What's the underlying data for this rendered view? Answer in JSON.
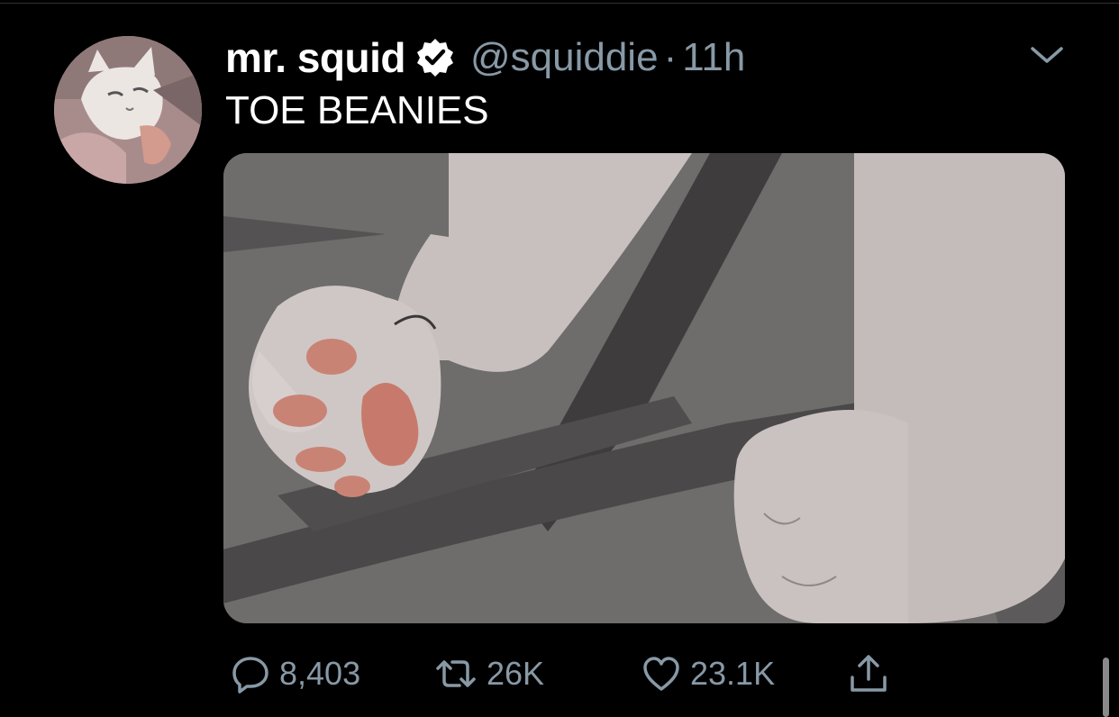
{
  "tweet": {
    "display_name": "mr. squid",
    "handle": "@squiddie",
    "separator": "·",
    "time": "11h",
    "text": "TOE BEANIES",
    "verified": true
  },
  "actions": {
    "reply_count": "8,403",
    "retweet_count": "26K",
    "like_count": "23.1K"
  },
  "icons": {
    "reply": "reply-icon",
    "retweet": "retweet-icon",
    "like": "heart-icon",
    "share": "share-icon",
    "more": "chevron-down-icon",
    "verified": "verified-badge-icon"
  },
  "colors": {
    "background": "#000000",
    "text_primary": "#ffffff",
    "text_secondary": "#8899a6",
    "media_gray": "#6d6a6a"
  }
}
